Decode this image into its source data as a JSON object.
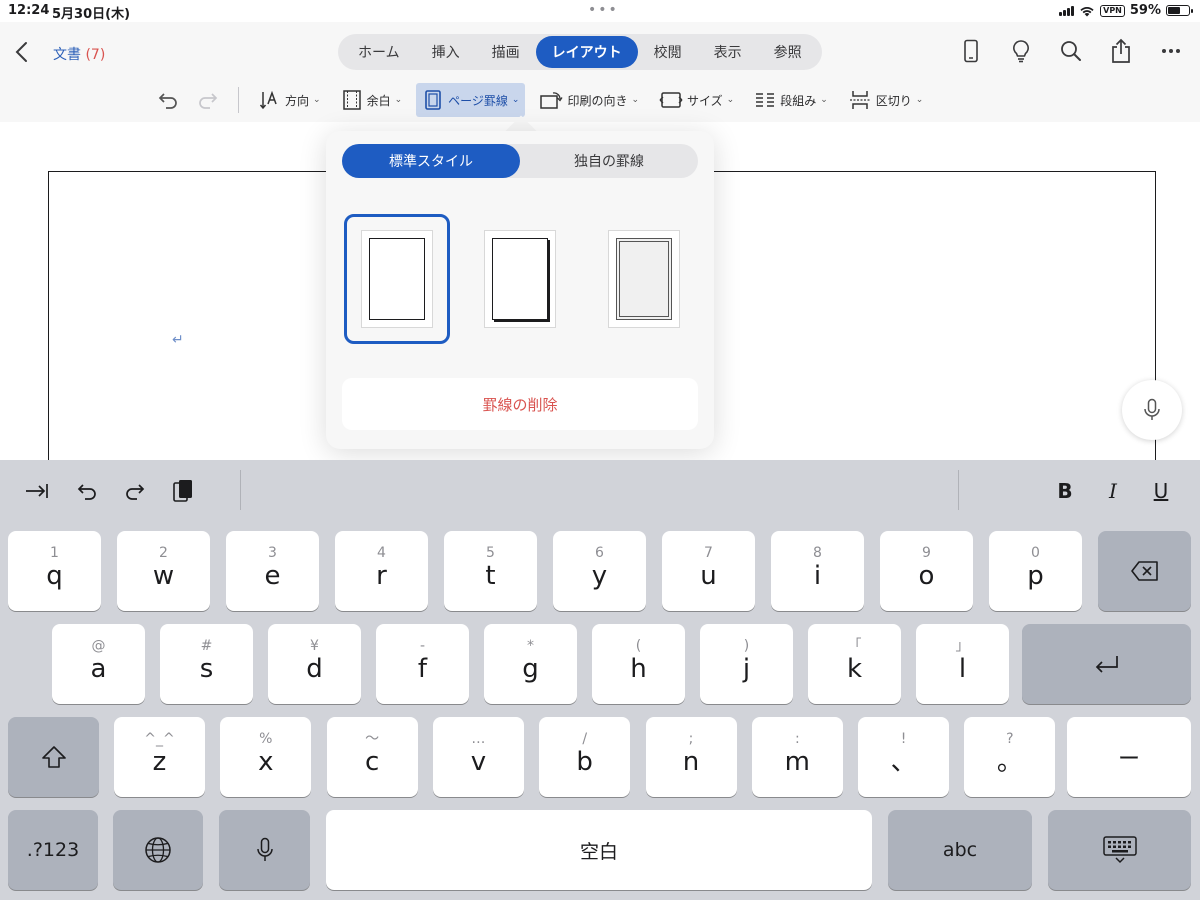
{
  "status": {
    "time": "12:24",
    "date": "5月30日(木)",
    "vpn": "VPN",
    "battery": "59%",
    "battery_level": 0.59
  },
  "header": {
    "doc_name": "文書",
    "doc_count": "(7)",
    "tabs": [
      {
        "label": "ホーム"
      },
      {
        "label": "挿入"
      },
      {
        "label": "描画"
      },
      {
        "label": "レイアウト",
        "active": true
      },
      {
        "label": "校閲"
      },
      {
        "label": "表示"
      },
      {
        "label": "参照"
      }
    ],
    "icons": [
      "phone-icon",
      "lightbulb-icon",
      "search-icon",
      "share-icon",
      "more-icon"
    ]
  },
  "toolbar": {
    "direction": "方向",
    "margins": "余白",
    "page_borders": "ページ罫線",
    "orientation": "印刷の向き",
    "size": "サイズ",
    "columns": "段組み",
    "breaks": "区切り"
  },
  "popover": {
    "segments": [
      "標準スタイル",
      "独自の罫線"
    ],
    "active_segment": 0,
    "styles": [
      "single-line-border",
      "shadow-border",
      "double-line-border"
    ],
    "selected_style": 0,
    "remove_label": "罫線の削除"
  },
  "document": {
    "paragraph_mark": "↵"
  },
  "keyboard": {
    "row1": [
      {
        "hint": "1",
        "main": "q"
      },
      {
        "hint": "2",
        "main": "w"
      },
      {
        "hint": "3",
        "main": "e"
      },
      {
        "hint": "4",
        "main": "r"
      },
      {
        "hint": "5",
        "main": "t"
      },
      {
        "hint": "6",
        "main": "y"
      },
      {
        "hint": "7",
        "main": "u"
      },
      {
        "hint": "8",
        "main": "i"
      },
      {
        "hint": "9",
        "main": "o"
      },
      {
        "hint": "0",
        "main": "p"
      }
    ],
    "row2": [
      {
        "hint": "@",
        "main": "a"
      },
      {
        "hint": "#",
        "main": "s"
      },
      {
        "hint": "¥",
        "main": "d"
      },
      {
        "hint": "-",
        "main": "f"
      },
      {
        "hint": "*",
        "main": "g"
      },
      {
        "hint": "(",
        "main": "h"
      },
      {
        "hint": ")",
        "main": "j"
      },
      {
        "hint": "「",
        "main": "k"
      },
      {
        "hint": "」",
        "main": "l"
      }
    ],
    "row3": [
      {
        "hint": "^_^",
        "main": "z"
      },
      {
        "hint": "%",
        "main": "x"
      },
      {
        "hint": "〜",
        "main": "c"
      },
      {
        "hint": "…",
        "main": "v"
      },
      {
        "hint": "/",
        "main": "b"
      },
      {
        "hint": ";",
        "main": "n"
      },
      {
        "hint": ":",
        "main": "m"
      },
      {
        "hint": "!",
        "main": "、"
      },
      {
        "hint": "?",
        "main": "。"
      }
    ],
    "dash": "ー",
    "numbers": ".?123",
    "space": "空白",
    "abc": "abc",
    "bold": "B",
    "italic": "I",
    "underline": "U"
  }
}
